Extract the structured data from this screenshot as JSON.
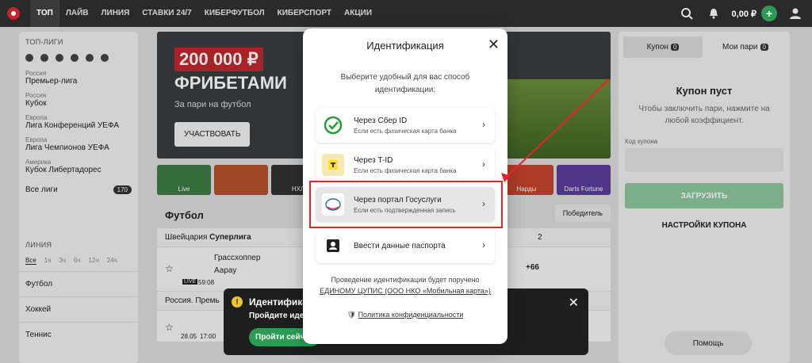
{
  "nav": {
    "items": [
      "ТОП",
      "ЛАЙВ",
      "ЛИНИЯ",
      "СТАВКИ 24/7",
      "КИБЕРФУТБОЛ",
      "КИБЕРСПОРТ",
      "АКЦИИ"
    ],
    "balance": "0,00 ₽",
    "plus": "+"
  },
  "sidebar": {
    "top_title": "ТОП-ЛИГИ",
    "leagues": [
      {
        "country": "Россия",
        "name": "Премьер-лига"
      },
      {
        "country": "Россия",
        "name": "Кубок"
      },
      {
        "country": "Европа",
        "name": "Лига Конференций УЕФА"
      },
      {
        "country": "Европа",
        "name": "Лига Чемпионов УЕФА"
      },
      {
        "country": "Америка",
        "name": "Кубок Либертадорес"
      }
    ],
    "all_leagues": "Все лиги",
    "all_count": "170",
    "line_title": "ЛИНИЯ",
    "filters": [
      "Все",
      "1ч",
      "3ч",
      "6ч",
      "12ч",
      "24ч"
    ],
    "sports": [
      "Футбол",
      "Хоккей",
      "Теннис"
    ]
  },
  "banner": {
    "amount": "200 000 ₽",
    "freebets": "ФРИБЕТАМИ",
    "subtitle": "За пари на футбол",
    "button": "УЧАСТВОВАТЬ"
  },
  "tiles": [
    "Live",
    "",
    "НХЛ",
    "",
    "",
    "",
    "Нарды",
    "Darts Fortune"
  ],
  "football": {
    "heading": "Футбол",
    "sort": "Победитель",
    "league1_country": "Швейцария",
    "league1_name": "Суперлига",
    "col2": "2",
    "team1": "Грассхоппер",
    "team2": "Аарау",
    "live": "LIVE",
    "time": "59:08",
    "more": "+66",
    "league2": "Россия. Премь",
    "date": "28.05",
    "date_time": "17:00"
  },
  "coupon": {
    "tab1": "Купон",
    "tab1_count": "0",
    "tab2": "Мои пари",
    "tab2_count": "0",
    "empty_title": "Купон пуст",
    "empty_text": "Чтобы заключить пари, нажмите на любой коэффициент.",
    "code_label": "Код купона",
    "load": "ЗАГРУЗИТЬ",
    "settings": "НАСТРОЙКИ КУПОНА",
    "help": "Помощь"
  },
  "toast": {
    "title": "Идентифика",
    "text": "Пройдите иде",
    "button": "Пройти сейчас"
  },
  "modal": {
    "title": "Идентификация",
    "description": "Выберите удобный для вас способ идентификации:",
    "options": [
      {
        "label": "Через Сбер ID",
        "sub": "Если есть физическая карта банка"
      },
      {
        "label": "Через T-ID",
        "sub": "Если есть физическая карта банка"
      },
      {
        "label": "Через портал Госуслуги",
        "sub": "Если есть подтвержденная запись"
      },
      {
        "label": "Ввести данные паспорта",
        "sub": ""
      }
    ],
    "footer_line1": "Проведение идентификации будет поручено",
    "footer_link": "ЕДИНОМУ ЦУПИС (ООО НКО «Мобильная карта»)",
    "privacy": "Политика конфиденциальности"
  },
  "colors": {
    "accent": "#2e9b55",
    "highlight": "#e8232a",
    "topbar": "#2a2a2a"
  }
}
